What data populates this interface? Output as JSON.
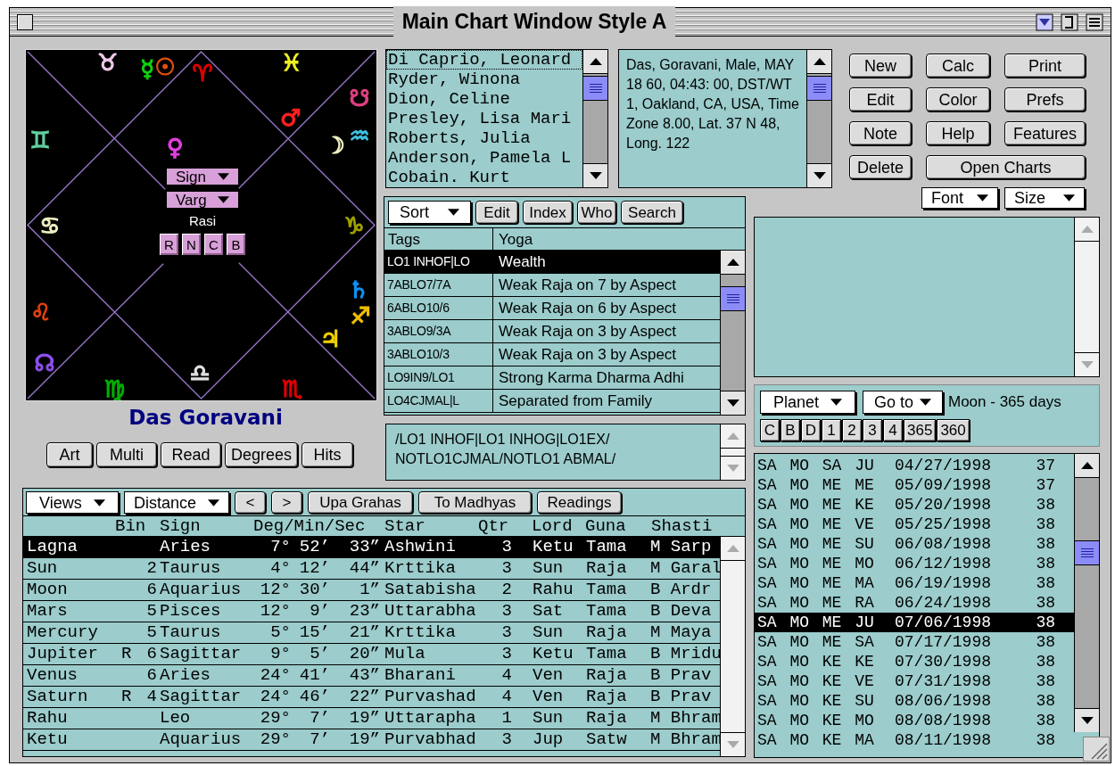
{
  "window": {
    "title": "Main Chart Window Style A"
  },
  "chart": {
    "glyphs": [
      {
        "symbol": "♉",
        "color": "#f0c8e8"
      },
      {
        "symbol": "☿",
        "color": "#10d010"
      },
      {
        "symbol": "☉",
        "color": "#e05010"
      },
      {
        "symbol": "♈",
        "color": "#e00000"
      },
      {
        "symbol": "♓",
        "color": "#f0f020"
      },
      {
        "symbol": "☋",
        "color": "#e04080"
      },
      {
        "symbol": "♂",
        "color": "#ff2020"
      },
      {
        "symbol": "♊",
        "color": "#60d0a0"
      },
      {
        "symbol": "♀",
        "color": "#e040e0"
      },
      {
        "symbol": "☽",
        "color": "#f0f0c0"
      },
      {
        "symbol": "♒",
        "color": "#40c0e0"
      },
      {
        "symbol": "♋",
        "color": "#f0f0c0"
      },
      {
        "symbol": "♑",
        "color": "#a0a000"
      },
      {
        "symbol": "♄",
        "color": "#1090f0"
      },
      {
        "symbol": "♌",
        "color": "#e04010"
      },
      {
        "symbol": "♐",
        "color": "#f0c000"
      },
      {
        "symbol": "♃",
        "color": "#f0d000"
      },
      {
        "symbol": "☊",
        "color": "#9050f0"
      },
      {
        "symbol": "♍",
        "color": "#00b000"
      },
      {
        "symbol": "♎",
        "color": "#e0e0e0"
      },
      {
        "symbol": "♏",
        "color": "#e00000"
      }
    ],
    "sign_dropdown": "Sign",
    "varg_dropdown": "Varg",
    "division": "Rasi",
    "mode_buttons": [
      "R",
      "N",
      "C",
      "B"
    ]
  },
  "native_name": "Das Goravani",
  "chart_buttons": [
    "Art",
    "Multi",
    "Read",
    "Degrees",
    "Hits"
  ],
  "charts_list": [
    {
      "label": "Di Caprio, Leonard",
      "selected": true
    },
    {
      "label": "Ryder, Winona",
      "selected": false
    },
    {
      "label": "Dion, Celine",
      "selected": false
    },
    {
      "label": "Presley, Lisa Mari",
      "selected": false
    },
    {
      "label": "Roberts, Julia",
      "selected": false
    },
    {
      "label": "Anderson, Pamela L",
      "selected": false
    },
    {
      "label": "Cobain. Kurt",
      "selected": false
    }
  ],
  "chart_info": "Das, Goravani, Male, MAY 18 60, 04:43: 00, DST/WT 1, Oakland, CA, USA, Time Zone 8.00, Lat. 37 N 48, Long. 122",
  "action_buttons": [
    "New",
    "Calc",
    "Print",
    "Edit",
    "Color",
    "Prefs",
    "Note",
    "Help",
    "Features",
    "Delete",
    "Open Charts"
  ],
  "font_dropdown": "Font",
  "size_dropdown": "Size",
  "yoga_panel": {
    "sort_dropdown": "Sort",
    "buttons": [
      "Edit",
      "Index",
      "Who",
      "Search"
    ],
    "columns": [
      "Tags",
      "Yoga"
    ],
    "rows": [
      {
        "tags": "LO1 INHOF|LO",
        "yoga": "Wealth",
        "selected": true
      },
      {
        "tags": "7ABLO7/7A",
        "yoga": "Weak Raja on 7 by Aspect",
        "selected": false
      },
      {
        "tags": "6ABLO10/6",
        "yoga": "Weak Raja on 6 by Aspect",
        "selected": false
      },
      {
        "tags": "3ABLO9/3A",
        "yoga": "Weak Raja on 3 by Aspect",
        "selected": false
      },
      {
        "tags": "3ABLO10/3",
        "yoga": "Weak Raja on 3 by Aspect",
        "selected": false
      },
      {
        "tags": "LO9IN9/LO1",
        "yoga": "Strong Karma Dharma Adhi",
        "selected": false
      },
      {
        "tags": "LO4CJMAL|L",
        "yoga": "Separated from Family",
        "selected": false
      }
    ]
  },
  "yoga_tags_text": "/LO1 INHOF|LO1 INHOG|LO1EX/ NOTLO1CJMAL/NOTLO1 ABMAL/",
  "dasha_controls": {
    "planet_dropdown": "Planet",
    "goto_dropdown": "Go to",
    "period_label": "Moon - 365 days",
    "buttons": [
      "C",
      "B",
      "D",
      "1",
      "2",
      "3",
      "4",
      "365",
      "360"
    ]
  },
  "dasha_list": [
    {
      "periods": "SA MO SA JU",
      "date": "04/27/1998",
      "column_3": "37",
      "selected": false
    },
    {
      "periods": "SA MO ME ME",
      "date": "05/09/1998",
      "column_3": "37",
      "selected": false
    },
    {
      "periods": "SA MO ME KE",
      "date": "05/20/1998",
      "column_3": "38",
      "selected": false
    },
    {
      "periods": "SA MO ME VE",
      "date": "05/25/1998",
      "column_3": "38",
      "selected": false
    },
    {
      "periods": "SA MO ME SU",
      "date": "06/08/1998",
      "column_3": "38",
      "selected": false
    },
    {
      "periods": "SA MO ME MO",
      "date": "06/12/1998",
      "column_3": "38",
      "selected": false
    },
    {
      "periods": "SA MO ME MA",
      "date": "06/19/1998",
      "column_3": "38",
      "selected": false
    },
    {
      "periods": "SA MO ME RA",
      "date": "06/24/1998",
      "column_3": "38",
      "selected": false
    },
    {
      "periods": "SA MO ME JU",
      "date": "07/06/1998",
      "column_3": "38",
      "selected": true
    },
    {
      "periods": "SA MO ME SA",
      "date": "07/17/1998",
      "column_3": "38",
      "selected": false
    },
    {
      "periods": "SA MO KE KE",
      "date": "07/30/1998",
      "column_3": "38",
      "selected": false
    },
    {
      "periods": "SA MO KE VE",
      "date": "07/31/1998",
      "column_3": "38",
      "selected": false
    },
    {
      "periods": "SA MO KE SU",
      "date": "08/06/1998",
      "column_3": "38",
      "selected": false
    },
    {
      "periods": "SA MO KE MO",
      "date": "08/08/1998",
      "column_3": "38",
      "selected": false
    },
    {
      "periods": "SA MO KE MA",
      "date": "08/11/1998",
      "column_3": "38",
      "selected": false
    }
  ],
  "planets_toolbar": {
    "views_dropdown": "Views",
    "distance_dropdown": "Distance",
    "buttons": [
      "<",
      ">",
      "Upa Grahas",
      "To Madhyas",
      "Readings"
    ]
  },
  "planets_table": {
    "columns": [
      "Bin",
      "Sign",
      "Deg/Min/Sec",
      "Star",
      "Qtr",
      "Lord",
      "Guna",
      "Shasti"
    ],
    "rows": [
      {
        "planet": "Lagna",
        "sign": "Aries",
        "deg": "7°",
        "min": "52’",
        "sec": "33”",
        "star": "Ashwini",
        "qtr": "3",
        "lord": "Ketu",
        "guna": "Tama",
        "shasti": "M Sarp",
        "selected": true
      },
      {
        "planet": "Sun",
        "bin": "2",
        "sign": "Taurus",
        "deg": "4°",
        "min": "12’",
        "sec": "44”",
        "star": "Krttika",
        "qtr": "3",
        "lord": "Sun",
        "guna": "Raja",
        "shasti": "M Garal",
        "selected": false
      },
      {
        "planet": "Moon",
        "bin": "6",
        "sign": "Aquarius",
        "deg": "12°",
        "min": "30’",
        "sec": "1”",
        "star": "Satabisha",
        "qtr": "2",
        "lord": "Rahu",
        "guna": "Tama",
        "shasti": "B Ardr",
        "selected": false
      },
      {
        "planet": "Mars",
        "bin": "5",
        "sign": "Pisces",
        "deg": "12°",
        "min": "9’",
        "sec": "23”",
        "star": "Uttarabha",
        "qtr": "3",
        "lord": "Sat",
        "guna": "Tama",
        "shasti": "B Deva",
        "selected": false
      },
      {
        "planet": "Mercury",
        "bin": "5",
        "sign": "Taurus",
        "deg": "5°",
        "min": "15’",
        "sec": "21”",
        "star": "Krttika",
        "qtr": "3",
        "lord": "Sun",
        "guna": "Raja",
        "shasti": "M Maya",
        "selected": false
      },
      {
        "planet": "Jupiter",
        "retro": "R",
        "bin": "6",
        "sign": "Sagittar",
        "deg": "9°",
        "min": "5’",
        "sec": "20”",
        "star": "Mula",
        "qtr": "3",
        "lord": "Ketu",
        "guna": "Tama",
        "shasti": "B Mridu",
        "selected": false
      },
      {
        "planet": "Venus",
        "bin": "6",
        "sign": "Aries",
        "deg": "24°",
        "min": "41’",
        "sec": "43”",
        "star": "Bharani",
        "qtr": "4",
        "lord": "Ven",
        "guna": "Raja",
        "shasti": "B Prav",
        "selected": false
      },
      {
        "planet": "Saturn",
        "retro": "R",
        "bin": "4",
        "sign": "Sagittar",
        "deg": "24°",
        "min": "46’",
        "sec": "22”",
        "star": "Purvashad",
        "qtr": "4",
        "lord": "Ven",
        "guna": "Raja",
        "shasti": "B Prav",
        "selected": false
      },
      {
        "planet": "Rahu",
        "sign": "Leo",
        "deg": "29°",
        "min": "7’",
        "sec": "19”",
        "star": "Uttarapha",
        "qtr": "1",
        "lord": "Sun",
        "guna": "Raja",
        "shasti": "M Bhram",
        "selected": false
      },
      {
        "planet": "Ketu",
        "sign": "Aquarius",
        "deg": "29°",
        "min": "7’",
        "sec": "19”",
        "star": "Purvabhad",
        "qtr": "3",
        "lord": "Jup",
        "guna": "Satw",
        "shasti": "M Bhram",
        "selected": false
      }
    ]
  }
}
